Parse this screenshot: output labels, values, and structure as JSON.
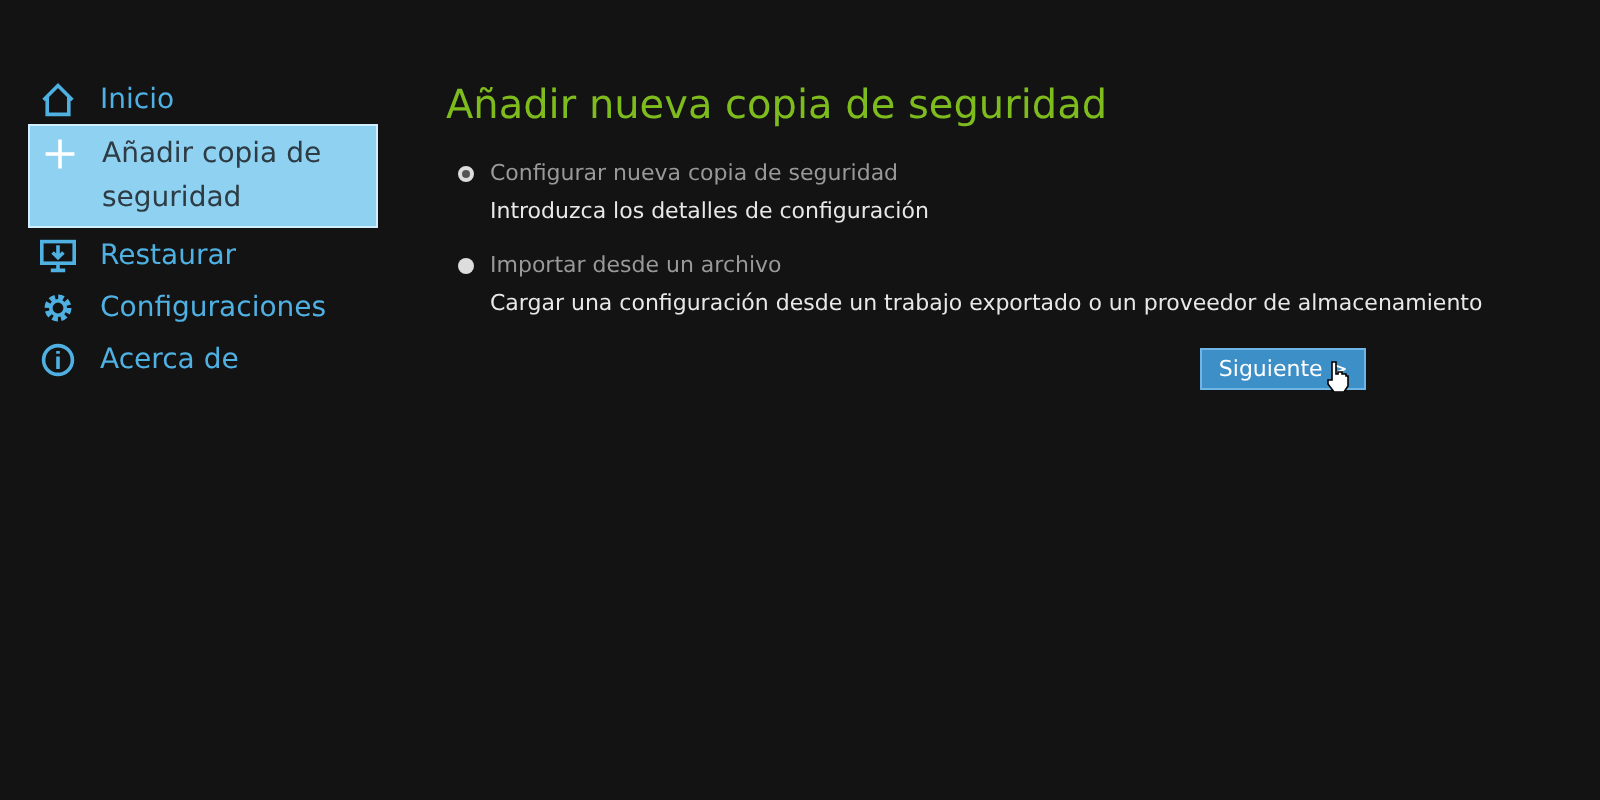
{
  "sidebar": {
    "items": [
      {
        "label": "Inicio",
        "selected": false
      },
      {
        "label": "Añadir copia de seguridad",
        "selected": true
      },
      {
        "label": "Restaurar",
        "selected": false
      },
      {
        "label": "Configuraciones",
        "selected": false
      },
      {
        "label": "Acerca de",
        "selected": false
      }
    ]
  },
  "main": {
    "title": "Añadir nueva copia de seguridad",
    "options": [
      {
        "label": "Configurar nueva copia de seguridad",
        "description": "Introduzca los detalles de configuración",
        "selected": true
      },
      {
        "label": "Importar desde un archivo",
        "description": "Cargar una configuración desde un trabajo exportado o un proveedor de almacenamiento",
        "selected": false
      }
    ],
    "next_button": "Siguiente >"
  }
}
